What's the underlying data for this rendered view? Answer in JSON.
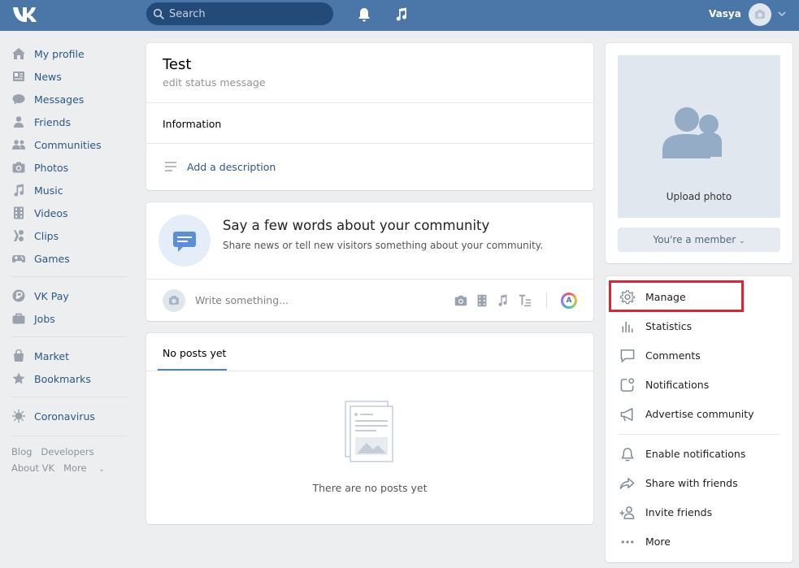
{
  "header": {
    "search_placeholder": "Search",
    "user_name": "Vasya",
    "icons": [
      "vk-logo-icon",
      "search-icon",
      "bell-icon",
      "music-icon",
      "camera-icon",
      "chevron-down-icon"
    ],
    "bg_color": "#4a76a8"
  },
  "sidebar": {
    "main": [
      {
        "label": "My profile",
        "icon": "home-icon"
      },
      {
        "label": "News",
        "icon": "news-icon"
      },
      {
        "label": "Messages",
        "icon": "messages-icon"
      },
      {
        "label": "Friends",
        "icon": "friends-icon"
      },
      {
        "label": "Communities",
        "icon": "communities-icon"
      },
      {
        "label": "Photos",
        "icon": "photo-icon"
      },
      {
        "label": "Music",
        "icon": "music-icon"
      },
      {
        "label": "Videos",
        "icon": "video-icon"
      },
      {
        "label": "Clips",
        "icon": "clips-icon"
      },
      {
        "label": "Games",
        "icon": "games-icon"
      }
    ],
    "services": [
      {
        "label": "VK Pay",
        "icon": "vkpay-icon"
      },
      {
        "label": "Jobs",
        "icon": "jobs-icon"
      }
    ],
    "extra": [
      {
        "label": "Market",
        "icon": "market-icon"
      },
      {
        "label": "Bookmarks",
        "icon": "star-icon"
      }
    ],
    "special": [
      {
        "label": "Coronavirus",
        "icon": "virus-icon"
      }
    ],
    "footer": {
      "blog": "Blog",
      "developers": "Developers",
      "about": "About VK",
      "more": "More"
    }
  },
  "community": {
    "name": "Test",
    "status_placeholder": "edit status message",
    "info_title": "Information",
    "add_description": "Add a description"
  },
  "prompt": {
    "title": "Say a few words about your community",
    "subtitle": "Share news or tell new visitors something about your community.",
    "write_placeholder": "Write something...",
    "accent_color": "#4a76a8"
  },
  "posts": {
    "tab": "No posts yet",
    "empty_text": "There are no posts yet"
  },
  "right": {
    "upload_photo": "Upload photo",
    "member_button": "You're a member",
    "menu": [
      {
        "label": "Manage",
        "icon": "gear-icon",
        "highlighted": true
      },
      {
        "label": "Statistics",
        "icon": "stats-icon"
      },
      {
        "label": "Comments",
        "icon": "comment-icon"
      },
      {
        "label": "Notifications",
        "icon": "notification-icon"
      },
      {
        "label": "Advertise community",
        "icon": "megaphone-icon"
      }
    ],
    "menu2": [
      {
        "label": "Enable notifications",
        "icon": "bell-icon"
      },
      {
        "label": "Share with friends",
        "icon": "share-icon"
      },
      {
        "label": "Invite friends",
        "icon": "add-user-icon"
      },
      {
        "label": "More",
        "icon": "more-icon"
      }
    ],
    "highlight_color": "#e3212f"
  }
}
